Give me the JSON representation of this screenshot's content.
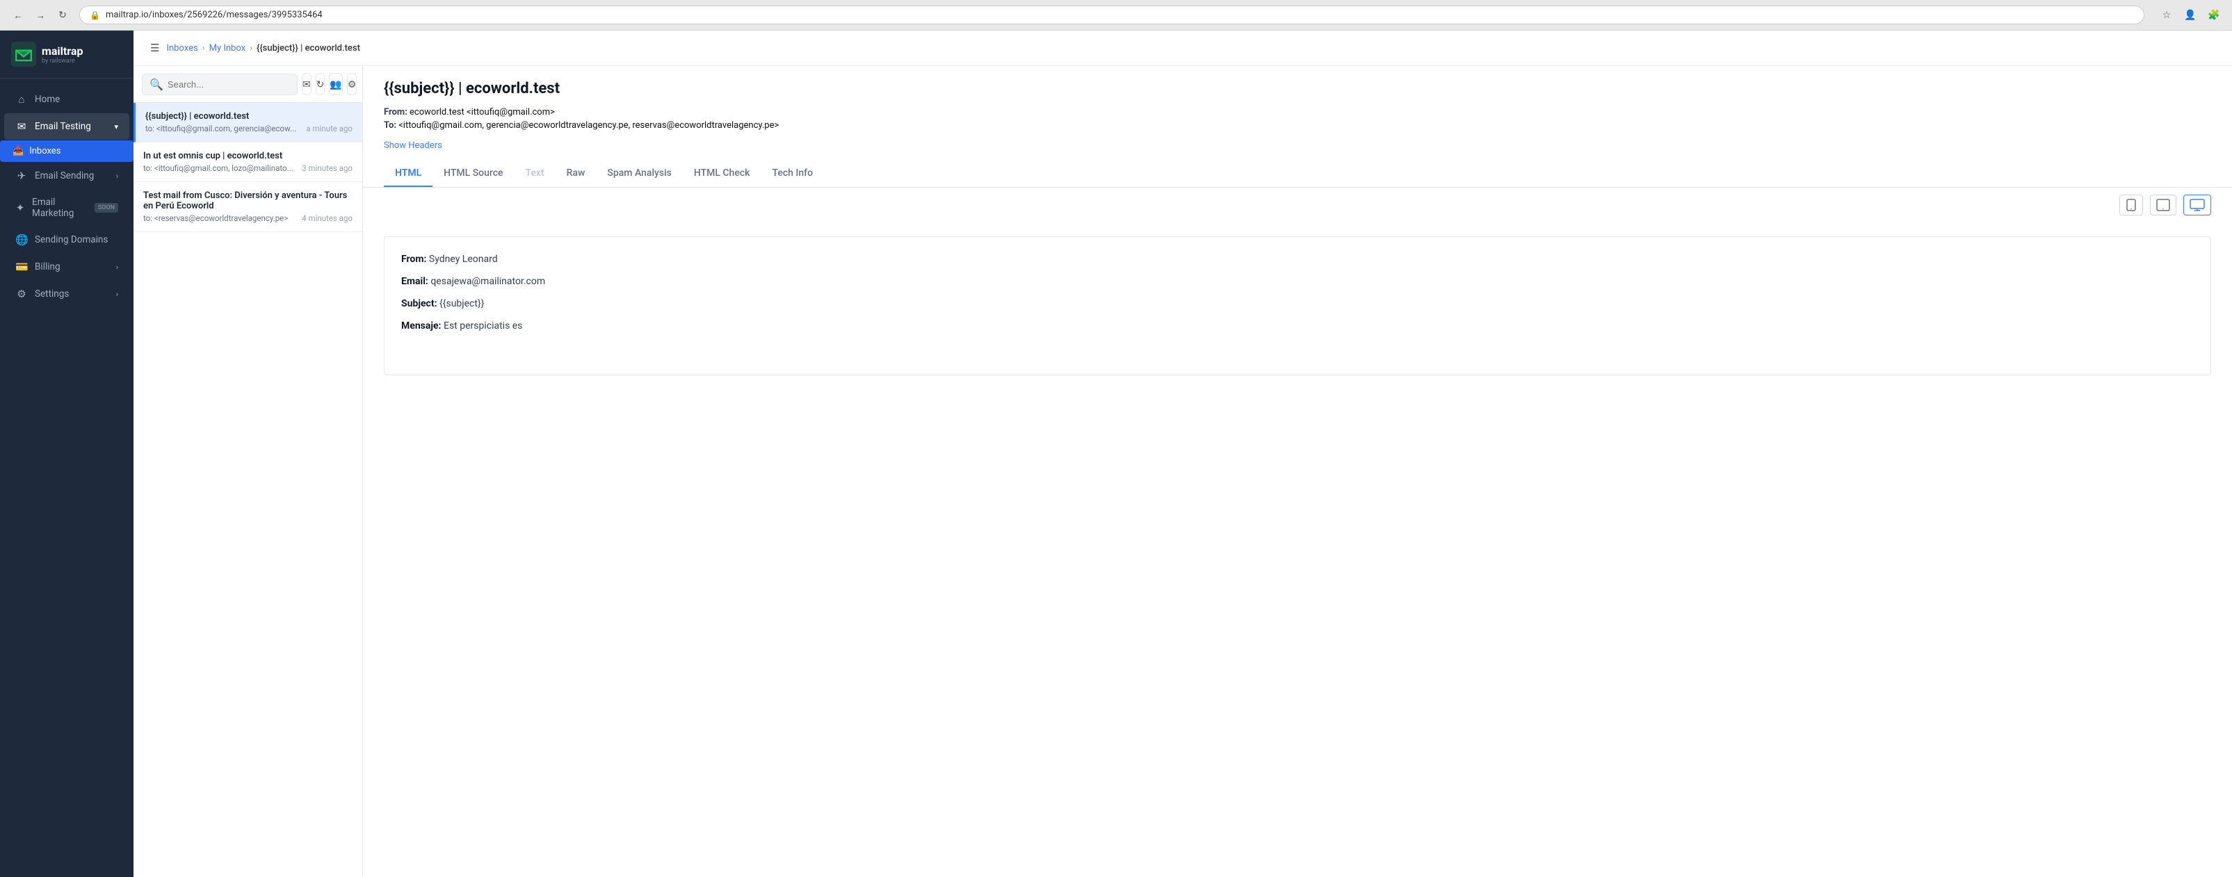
{
  "browser": {
    "url": "mailtrap.io/inboxes/2569226/messages/3995335464",
    "back_label": "←",
    "forward_label": "→",
    "refresh_label": "↻"
  },
  "breadcrumb": {
    "menu_label": "☰",
    "inboxes_label": "Inboxes",
    "my_inbox_label": "My Inbox",
    "current_label": "{{subject}} | ecoworld.test"
  },
  "sidebar": {
    "logo_main": "mailtrap",
    "logo_sub": "by railsware",
    "nav_items": [
      {
        "id": "home",
        "label": "Home",
        "icon": "⌂"
      },
      {
        "id": "email-testing",
        "label": "Email Testing",
        "icon": "✉",
        "has_chevron": true
      },
      {
        "id": "inboxes",
        "label": "Inboxes",
        "icon": "📥",
        "is_child": true
      },
      {
        "id": "email-sending",
        "label": "Email Sending",
        "icon": "✈",
        "has_chevron": true
      },
      {
        "id": "email-marketing",
        "label": "Email Marketing",
        "icon": "✦",
        "badge": "soon"
      },
      {
        "id": "sending-domains",
        "label": "Sending Domains",
        "icon": "🌐"
      },
      {
        "id": "billing",
        "label": "Billing",
        "icon": "💳",
        "has_chevron": true
      },
      {
        "id": "settings",
        "label": "Settings",
        "icon": "⚙",
        "has_chevron": true
      }
    ]
  },
  "toolbar": {
    "search_placeholder": "Search...",
    "search_icon": "🔍",
    "compose_icon": "✉",
    "refresh_icon": "↻",
    "contacts_icon": "👥",
    "settings_icon": "⚙"
  },
  "messages": [
    {
      "subject": "{{subject}} | ecoworld.test",
      "to": "to: <ittoufiq@gmail.com, gerencia@ecow...",
      "time": "a minute ago",
      "active": true
    },
    {
      "subject": "In ut est omnis cup | ecoworld.test",
      "to": "to: <ittoufiq@gmail.com, lozo@mailinato...",
      "time": "3 minutes ago",
      "active": false
    },
    {
      "subject": "Test mail from Cusco: Diversión y aventura - Tours en Perú Ecoworld",
      "to": "to: <reservas@ecoworldtravelagency.pe>",
      "time": "4 minutes ago",
      "active": false
    }
  ],
  "email": {
    "subject": "{{subject}} | ecoworld.test",
    "from_label": "From:",
    "from_value": "ecoworld.test <ittoufiq@gmail.com>",
    "to_label": "To:",
    "to_value": "<ittoufiq@gmail.com, gerencia@ecoworldtravelagency.pe, reservas@ecoworldtravelagency.pe>",
    "show_headers": "Show Headers",
    "tabs": [
      {
        "id": "html",
        "label": "HTML",
        "active": true
      },
      {
        "id": "html-source",
        "label": "HTML Source",
        "active": false
      },
      {
        "id": "text",
        "label": "Text",
        "active": false,
        "disabled": true
      },
      {
        "id": "raw",
        "label": "Raw",
        "active": false
      },
      {
        "id": "spam-analysis",
        "label": "Spam Analysis",
        "active": false
      },
      {
        "id": "html-check",
        "label": "HTML Check",
        "active": false
      },
      {
        "id": "tech-info",
        "label": "Tech Info",
        "active": false
      }
    ],
    "content": {
      "from_label": "From:",
      "from_value": "Sydney Leonard",
      "email_label": "Email:",
      "email_value": "qesajewa@mailinator.com",
      "subject_label": "Subject:",
      "subject_value": "{{subject}}",
      "message_label": "Mensaje:",
      "message_value": "Est perspiciatis es"
    }
  }
}
